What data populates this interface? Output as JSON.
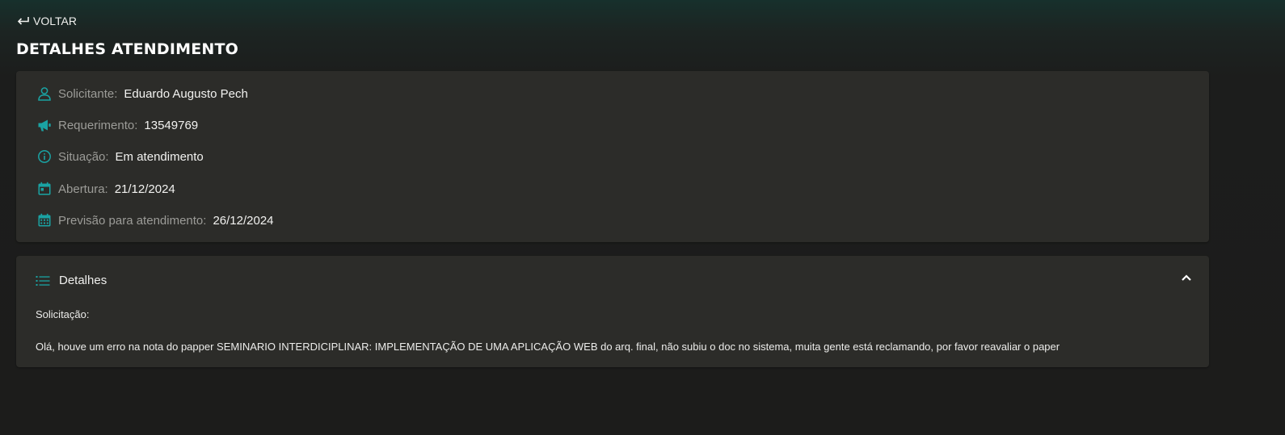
{
  "nav": {
    "back_label": "VOLTAR",
    "back_icon": "return-arrow-icon"
  },
  "page": {
    "title": "DETALHES ATENDIMENTO"
  },
  "info": {
    "solicitante": {
      "label": "Solicitante:",
      "value": "Eduardo Augusto Pech",
      "icon": "person-icon"
    },
    "requerimento": {
      "label": "Requerimento:",
      "value": "13549769",
      "icon": "megaphone-icon"
    },
    "situacao": {
      "label": "Situação:",
      "value": "Em atendimento",
      "icon": "info-icon"
    },
    "abertura": {
      "label": "Abertura:",
      "value": "21/12/2024",
      "icon": "calendar-icon"
    },
    "previsao": {
      "label": "Previsão para atendimento:",
      "value": "26/12/2024",
      "icon": "calendar-month-icon"
    }
  },
  "details": {
    "header": "Detalhes",
    "header_icon": "list-icon",
    "toggle_icon": "chevron-up-icon",
    "solicitacao_label": "Solicitação:",
    "solicitacao_text": "Olá, houve um erro na nota do papper SEMINARIO INTERDICIPLINAR: IMPLEMENTAÇÃO DE UMA APLICAÇÃO WEB do arq. final, não subiu o doc no sistema, muita gente está reclamando, por favor reavaliar o paper"
  },
  "colors": {
    "accent": "#1aa3a3",
    "card": "#2c2c29",
    "background": "#1c1c1b"
  }
}
